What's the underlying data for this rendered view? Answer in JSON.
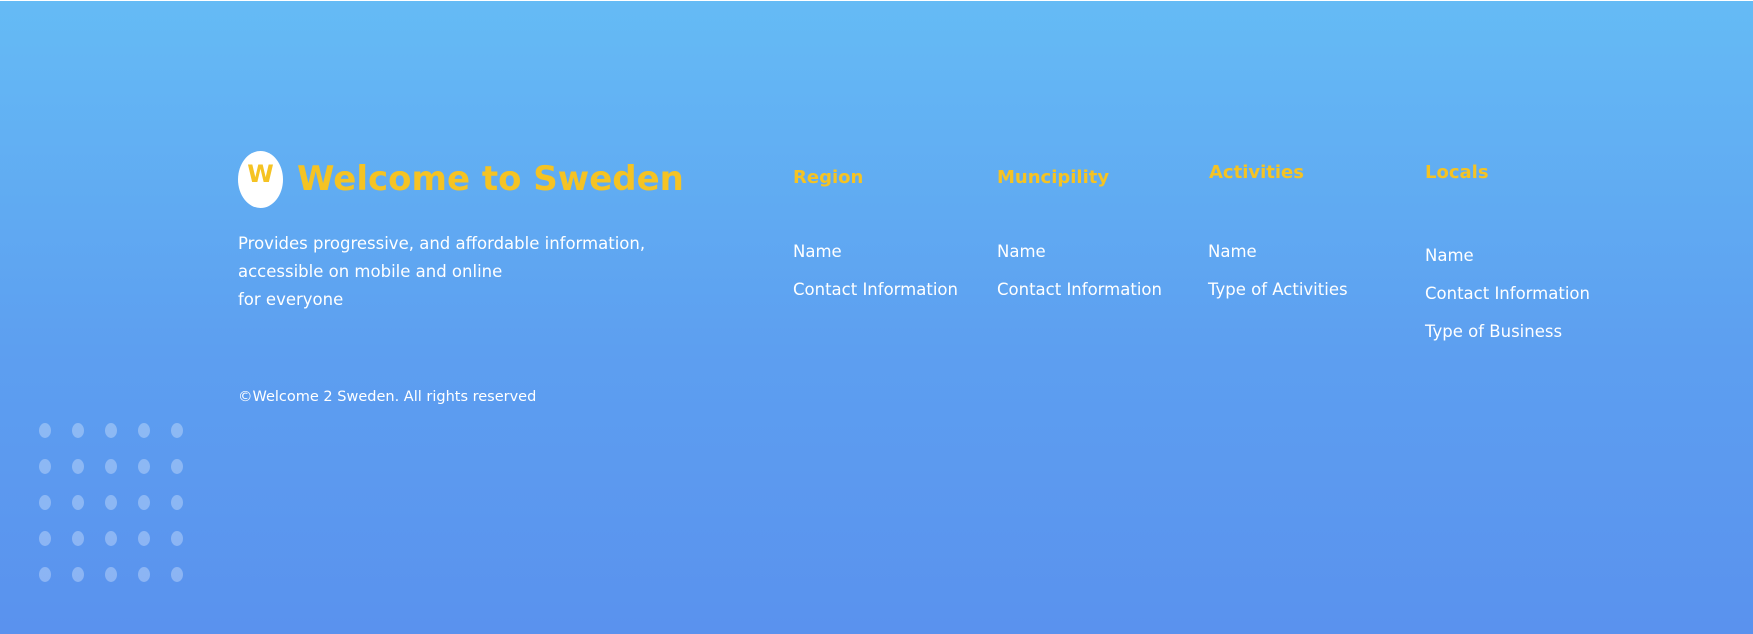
{
  "brand": {
    "logo_letter": "W",
    "title": "Welcome to Sweden",
    "tagline_lines": [
      "Provides progressive, and affordable information,",
      "accessible on mobile and online",
      "for everyone"
    ],
    "copyright": "©Welcome 2 Sweden. All rights reserved"
  },
  "columns": {
    "region": {
      "heading": "Region",
      "links": [
        "Name",
        "Contact Information"
      ]
    },
    "muncipility": {
      "heading": "Muncipility",
      "links": [
        "Name",
        "Contact Information"
      ]
    },
    "activities": {
      "heading": "Activities",
      "links": [
        "Name",
        "Type of Activities"
      ]
    },
    "locals": {
      "heading": "Locals",
      "links": [
        "Name",
        "Contact Information",
        "Type of Business"
      ]
    }
  },
  "colors": {
    "accent": "#f5c323",
    "background_top": "#65bbf5",
    "background_bottom": "#5a92ee",
    "text": "#ffffff"
  },
  "icons": {
    "logo": "w-logo-icon",
    "decoration": "dot-grid-icon"
  }
}
